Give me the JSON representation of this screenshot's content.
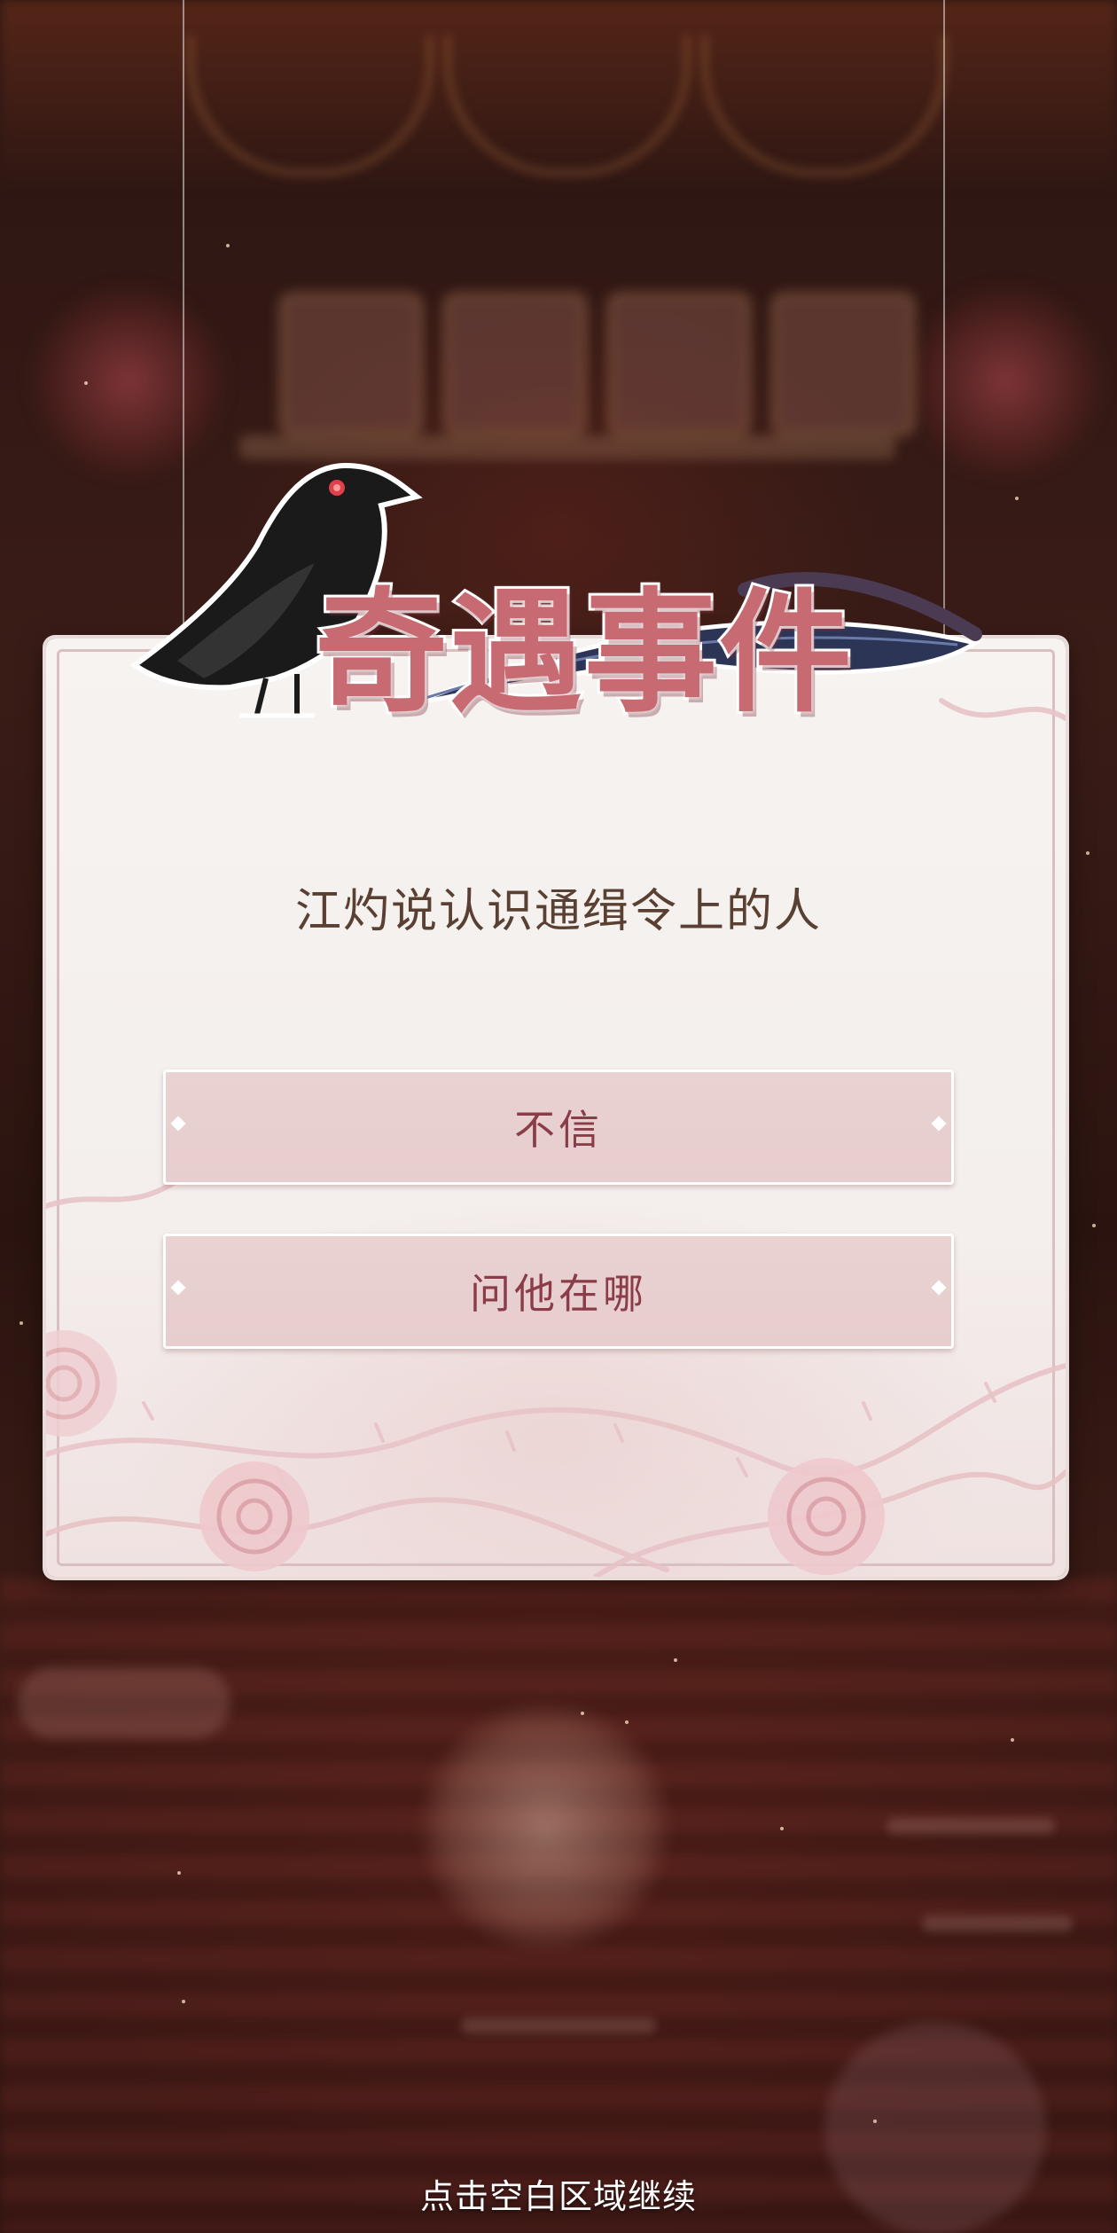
{
  "event_panel": {
    "title": "奇遇事件",
    "message": "江灼说认识通缉令上的人",
    "options": [
      {
        "label": "不信"
      },
      {
        "label": "问他在哪"
      }
    ]
  },
  "footer": {
    "continue_hint": "点击空白区域继续"
  },
  "colors": {
    "title": "#c76a72",
    "option_bg": "#ead2d2",
    "option_text": "#8a3c48",
    "message_text": "#5a4032",
    "panel_bg": "#f6f3f1"
  },
  "icons": [
    "crow-icon",
    "feather-icon",
    "rose-icon",
    "thorn-vine-icon"
  ]
}
